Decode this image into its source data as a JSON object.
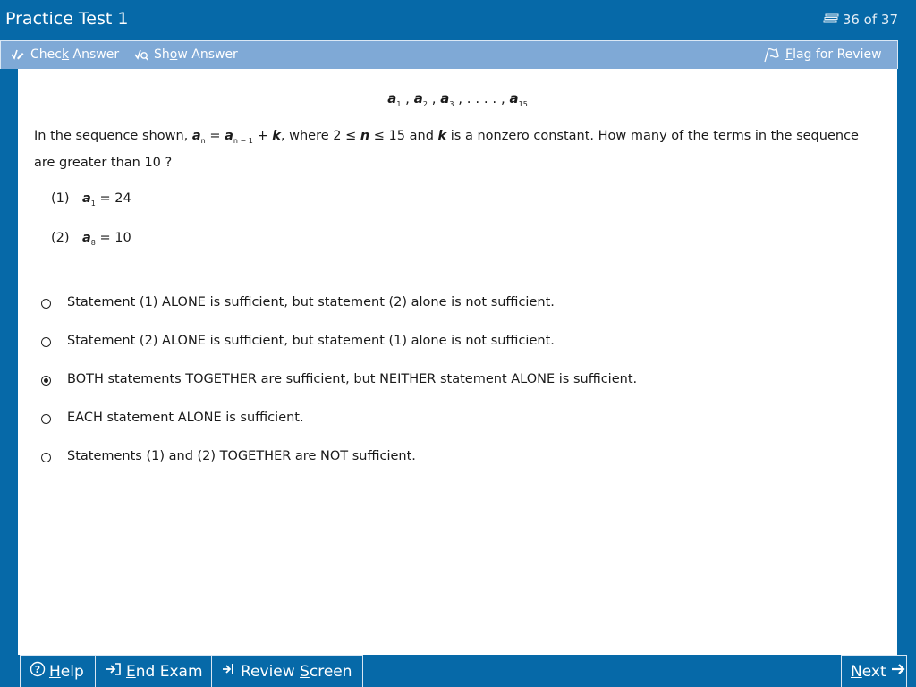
{
  "window": {
    "title": "Practice Test 1",
    "counter": "36 of 37",
    "counter_icon": "stack-icon"
  },
  "toolbar": {
    "check_answer": {
      "pre": "Chec",
      "key": "k",
      "post": " Answer"
    },
    "show_answer": {
      "pre": "Sh",
      "key": "o",
      "post": "w Answer"
    },
    "flag_for_review": {
      "pre": "",
      "key": "F",
      "post": "lag for Review"
    }
  },
  "question": {
    "sequence": {
      "var": "a",
      "sub1": "1",
      "sub2": "2",
      "sub3": "3",
      "dots": ". . . .",
      "sub_last": "15"
    },
    "stem": {
      "part1": "In the sequence shown, ",
      "a": "a",
      "n": "n",
      "eq": " = ",
      "sub_prev": "n − 1",
      "plus": " + ",
      "k": "k",
      "part2": ", where 2 ",
      "le1": " ≤ ",
      "part3": " ≤ 15 and ",
      "part4": " is a nonzero constant.  How many of the terms in the sequence are greater than 10 ?"
    },
    "statements": [
      {
        "num": "(1)",
        "var": "a",
        "sub": "1",
        "rest": " = 24"
      },
      {
        "num": "(2)",
        "var": "a",
        "sub": "8",
        "rest": " = 10"
      }
    ],
    "choices": [
      {
        "label": "Statement (1) ALONE is sufficient, but statement (2) alone is not sufficient.",
        "selected": false
      },
      {
        "label": "Statement (2) ALONE is sufficient, but statement (1) alone is not sufficient.",
        "selected": false
      },
      {
        "label": "BOTH statements TOGETHER are sufficient, but NEITHER statement ALONE is sufficient.",
        "selected": true
      },
      {
        "label": "EACH statement ALONE is sufficient.",
        "selected": false
      },
      {
        "label": "Statements (1) and (2) TOGETHER are NOT sufficient.",
        "selected": false
      }
    ]
  },
  "footer": {
    "help": {
      "pre": "",
      "key": "H",
      "post": "elp"
    },
    "end_exam": {
      "pre": "",
      "key": "E",
      "post": "nd Exam"
    },
    "review_screen": {
      "pre": "Review ",
      "key": "S",
      "post": "creen"
    },
    "next": {
      "pre": "",
      "key": "N",
      "post": "ext"
    }
  },
  "colors": {
    "frame": "#0669a8",
    "toolbar": "#7fa9d6",
    "content": "#ffffff"
  }
}
